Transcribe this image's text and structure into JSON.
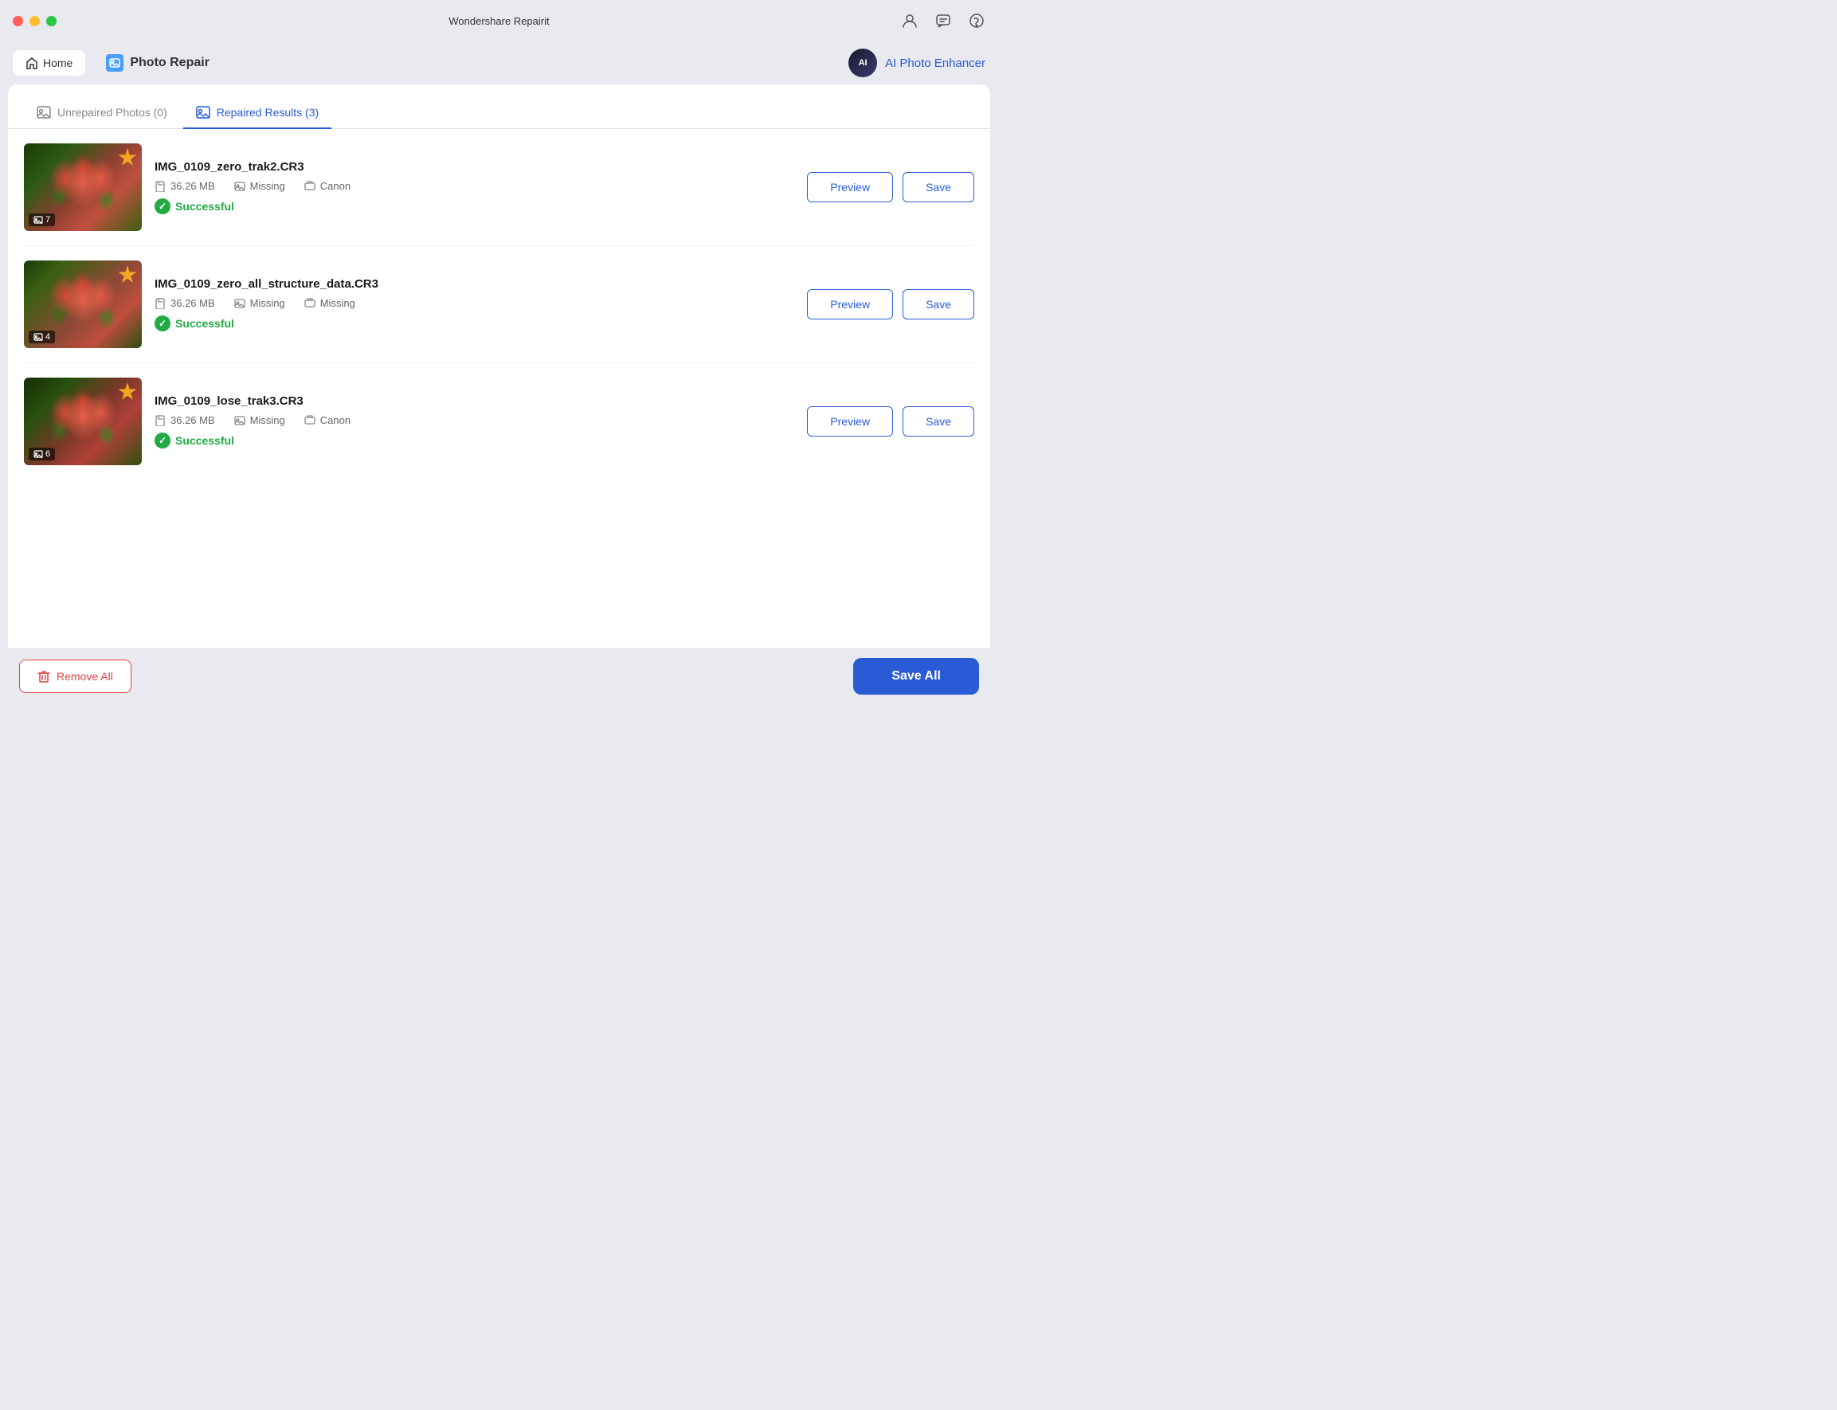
{
  "window": {
    "title": "Wondershare Repairit"
  },
  "nav": {
    "home_label": "Home",
    "photo_repair_label": "Photo Repair",
    "ai_enhancer_label": "AI Photo Enhancer"
  },
  "tabs": [
    {
      "id": "unrepaired",
      "label": "Unrepaired Photos (0)",
      "active": false
    },
    {
      "id": "repaired",
      "label": "Repaired Results (3)",
      "active": true
    }
  ],
  "files": [
    {
      "name": "IMG_0109_zero_trak2.CR3",
      "size": "36.26 MB",
      "field1": "Missing",
      "field2": "Canon",
      "count": "7",
      "status": "Successful"
    },
    {
      "name": "IMG_0109_zero_all_structure_data.CR3",
      "size": "36.26 MB",
      "field1": "Missing",
      "field2": "Missing",
      "count": "4",
      "status": "Successful"
    },
    {
      "name": "IMG_0109_lose_trak3.CR3",
      "size": "36.26 MB",
      "field1": "Missing",
      "field2": "Canon",
      "count": "6",
      "status": "Successful"
    }
  ],
  "buttons": {
    "preview": "Preview",
    "save": "Save",
    "remove_all": "Remove All",
    "save_all": "Save All"
  }
}
